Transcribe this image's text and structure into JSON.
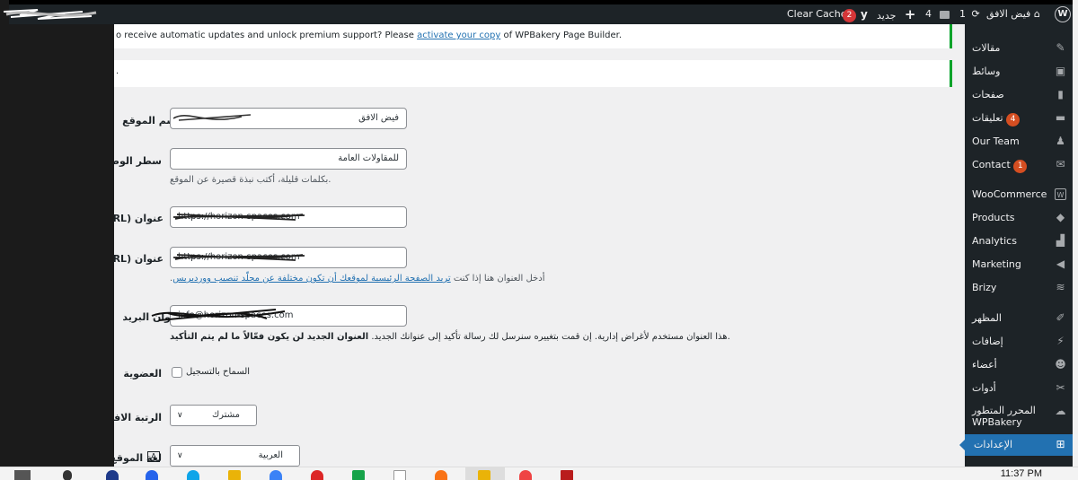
{
  "adminbar": {
    "wp_logo": "wordpress-icon",
    "site_name": "فيض الافق",
    "updates_count": "1",
    "comments_count": "4",
    "new_label": "جديد",
    "yoast_badge": "2",
    "clear_cache_label": "Clear Cache"
  },
  "notices": {
    "wpbakery_text_before": "o receive automatic updates and unlock premium support? Please ",
    "wpbakery_link": "activate your copy",
    "wpbakery_text_after": " of WPBakery Page Builder.",
    "second_notice_text": "."
  },
  "settings": {
    "site_title_label": "اسم الموقع",
    "site_title_value": "فيض الافق",
    "tagline_label": "سطر الوصف",
    "tagline_value": "للمقاولات العامة",
    "tagline_desc": ".بكلمات قليلة، أكتب نبذة قصيرة عن الموقع",
    "wp_address_label": "عنوان (URL)",
    "wp_address_value": "https://horizon-spaces.com",
    "site_address_label": "عنوان (URL)",
    "site_address_value": "https://horizon-spaces.com",
    "site_address_desc_before": "أدخل العنوان هنا إذا كنت ",
    "site_address_desc_link": "تريد الصفحة الرئيسية لموقعك أن تكون مختلفة عن مجلّد تنصيب ووردبريس",
    "site_address_desc_after": ".",
    "admin_email_label": "عنوان البريد",
    "admin_email_value": "info@horizon-spaces.com",
    "admin_email_desc_normal": ".هذا العنوان مستخدم لأغراض إدارية. إن قمت بتغييره سنرسل لك رسالة تأكيد إلى عنوانك الجديد. ",
    "admin_email_desc_bold": "العنوان الجديد لن يكون فعّالاً ما لم يتم التأكيد",
    "membership_label": "العضوية",
    "membership_checkbox_label": "السماح بالتسجيل",
    "default_role_label": "الرتبة الافتراضية",
    "default_role_value": "مشترك",
    "language_label": "لغة الموقع",
    "language_value": "العربية"
  },
  "menu": {
    "items": [
      {
        "label": "مقالات",
        "icon": "pin-icon"
      },
      {
        "label": "وسائط",
        "icon": "media-icon"
      },
      {
        "label": "صفحات",
        "icon": "page-icon"
      },
      {
        "label": "تعليقات",
        "badge": "4",
        "icon": "comment-icon"
      },
      {
        "label": "Our Team",
        "icon": "team-icon"
      },
      {
        "label": "Contact",
        "badge": "1",
        "icon": "mail-icon"
      },
      {
        "label": "WooCommerce",
        "icon": "woo-icon"
      },
      {
        "label": "Products",
        "icon": "box-icon"
      },
      {
        "label": "Analytics",
        "icon": "bar-chart-icon"
      },
      {
        "label": "Marketing",
        "icon": "megaphone-icon"
      },
      {
        "label": "Brizy",
        "icon": "layers-icon"
      },
      {
        "label": "المظهر",
        "icon": "brush-icon"
      },
      {
        "label": "إضافات",
        "icon": "plugin-icon"
      },
      {
        "label": "أعضاء",
        "icon": "user-icon"
      },
      {
        "label": "أدوات",
        "icon": "wrench-icon"
      },
      {
        "label": "المحرر المتطور",
        "label2": "WPBakery",
        "icon": "wpbakery-icon"
      },
      {
        "label": "الإعدادات",
        "icon": "settings-icon"
      }
    ]
  },
  "taskbar": {
    "clock": "11:37 PM"
  }
}
